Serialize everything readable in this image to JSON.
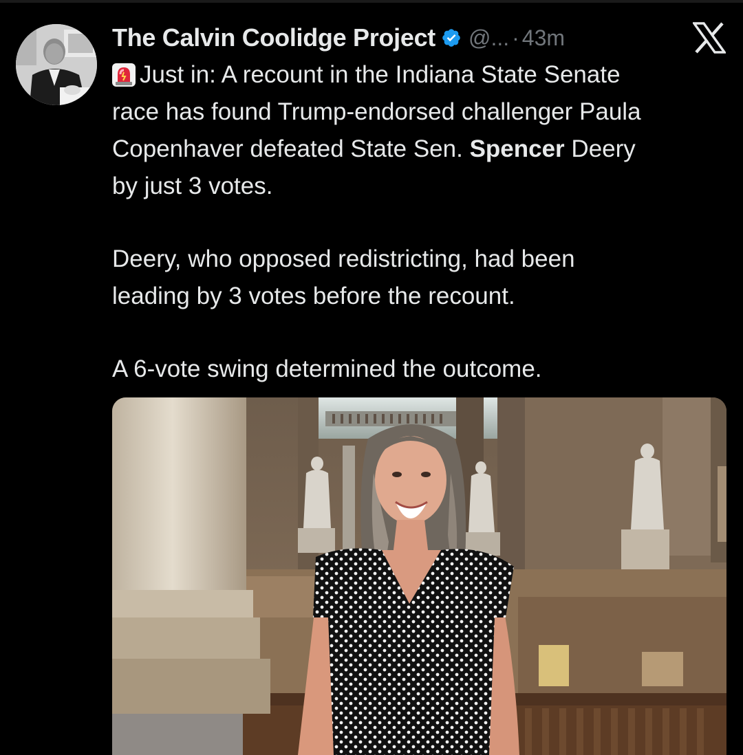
{
  "tweet": {
    "author_name": "The Calvin Coolidge Project",
    "handle": "@...",
    "separator": "·",
    "time": "43m",
    "verified": true,
    "avatar_icon": "portrait-avatar-icon",
    "verified_icon": "verified-badge-icon",
    "platform_icon": "x-logo-icon",
    "alert_icon": "rotating-light-emoji-icon",
    "lines": {
      "l1": "Just in: A recount in the Indiana State Senate",
      "l2": "race has found Trump-endorsed challenger Paula",
      "l3_pre": "Copenhaver defeated State Sen. ",
      "l3_bold": "Spencer",
      "l3_post": " Deery",
      "l4": "by just 3 votes.",
      "l5": "Deery, who opposed redistricting, had been",
      "l6": "leading by 3 votes before the recount.",
      "l7": "A 6-vote swing determined the outcome."
    },
    "media_alt": "Photo of woman in polka-dot dress inside statehouse"
  },
  "colors": {
    "background": "#000000",
    "text": "#e7e9ea",
    "muted": "#71767b",
    "verified_blue": "#1d9bf0"
  }
}
